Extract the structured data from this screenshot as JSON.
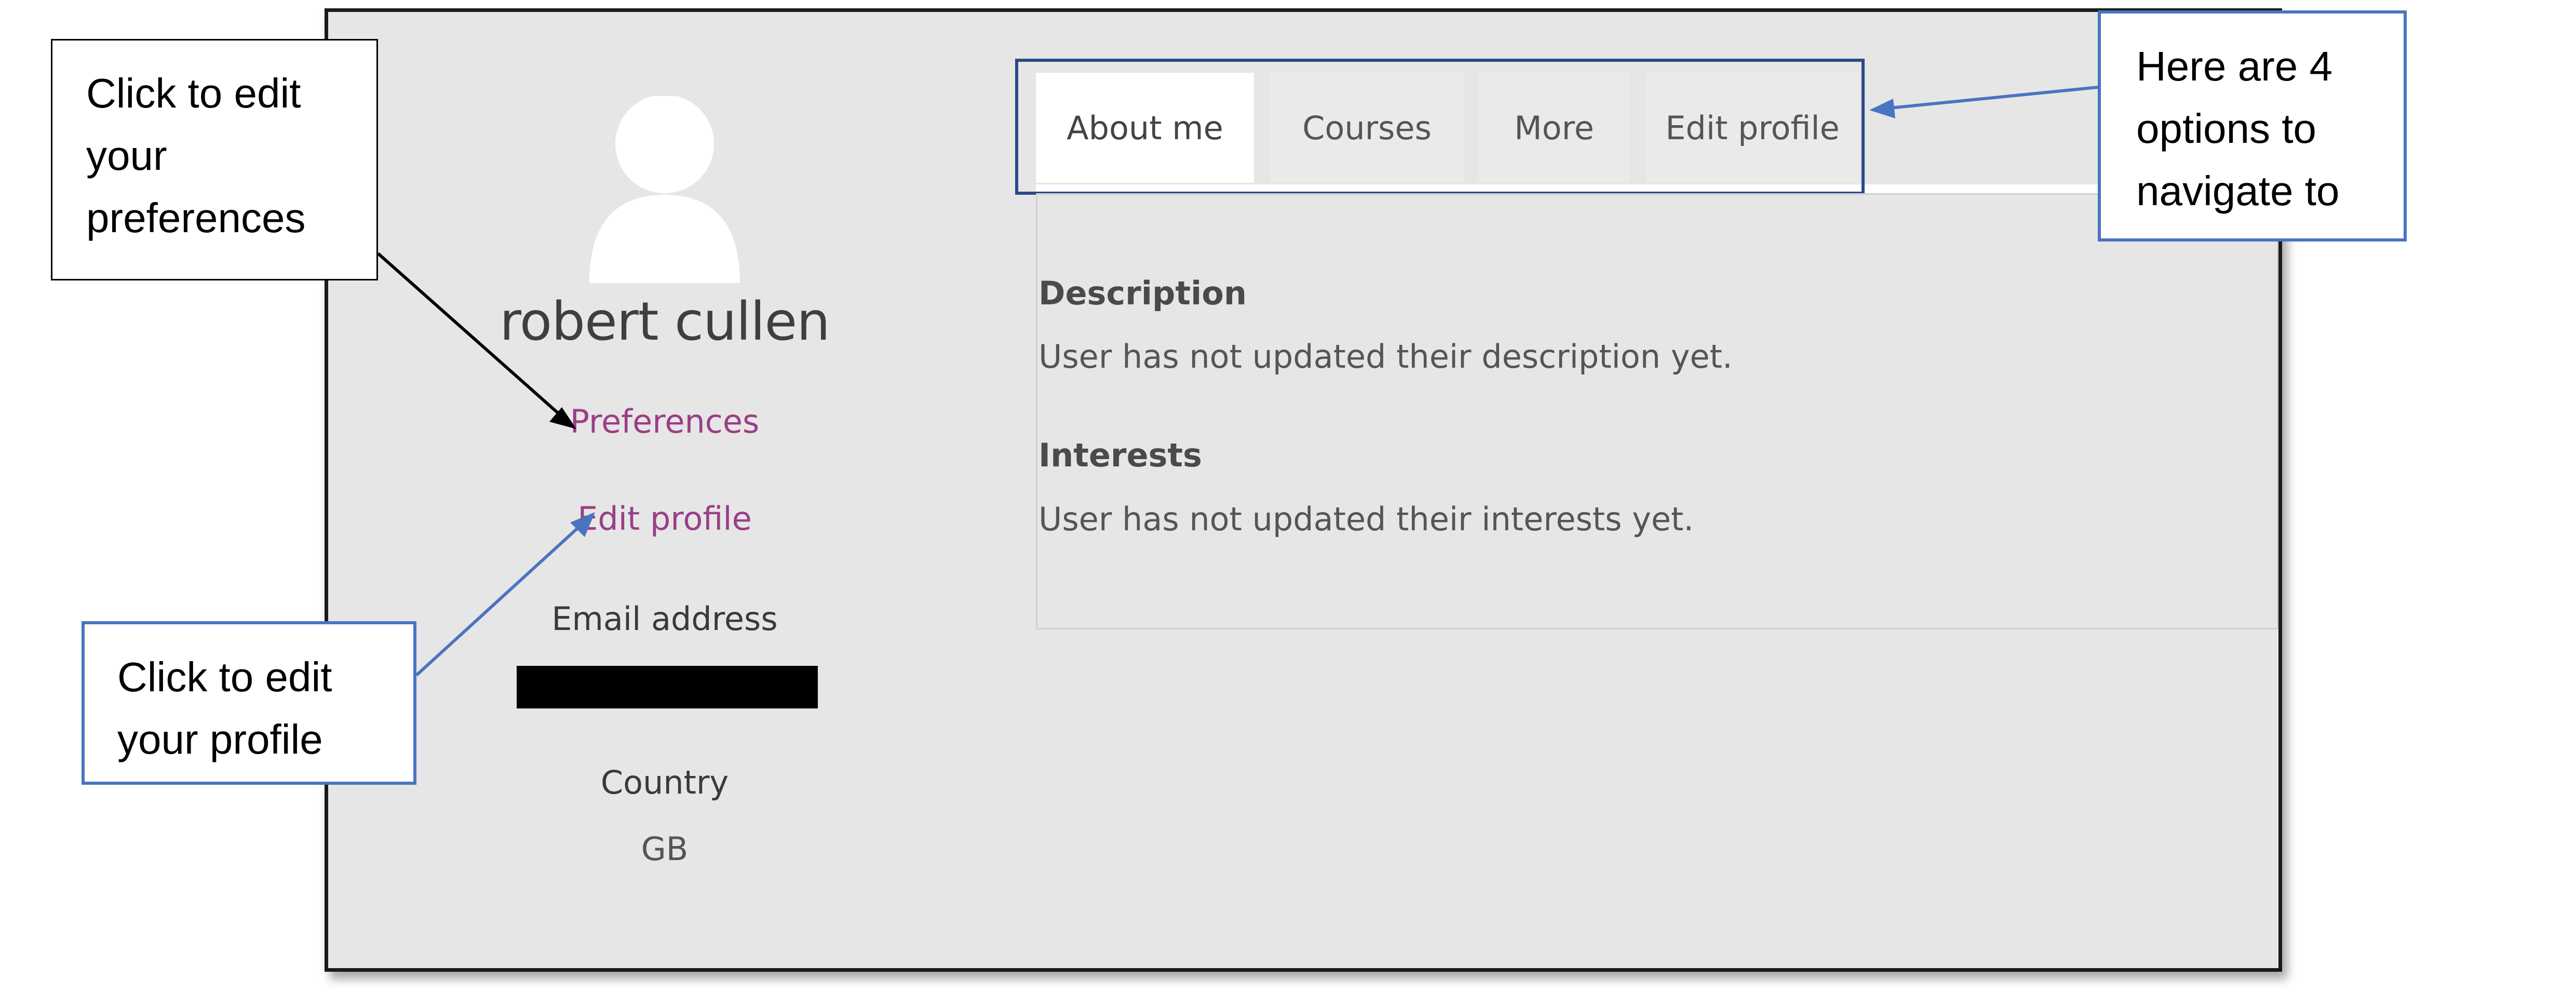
{
  "profile": {
    "name": "robert cullen",
    "links": {
      "preferences": "Preferences",
      "edit_profile": "Edit profile"
    },
    "email_label": "Email address",
    "email_value": "",
    "country_label": "Country",
    "country_value": "GB"
  },
  "tabs": [
    {
      "label": "About me",
      "active": true
    },
    {
      "label": "Courses",
      "active": false
    },
    {
      "label": "More",
      "active": false
    },
    {
      "label": "Edit profile",
      "active": false
    }
  ],
  "about": {
    "description_heading": "Description",
    "description_text": "User has not updated their description yet.",
    "interests_heading": "Interests",
    "interests_text": "User has not updated their interests yet."
  },
  "callouts": {
    "preferences": [
      "Click to edit",
      "your",
      "preferences"
    ],
    "profile": [
      "Click to edit",
      "your profile"
    ],
    "tabs": [
      "Here are 4",
      "options to",
      "navigate to"
    ]
  },
  "colors": {
    "link": "#9b3e86",
    "callout_blue": "#4a74c0",
    "tab_box": "#2b4a8b",
    "panel_bg": "#e6e6e6"
  },
  "icons": {
    "avatar": "user-silhouette-icon"
  }
}
